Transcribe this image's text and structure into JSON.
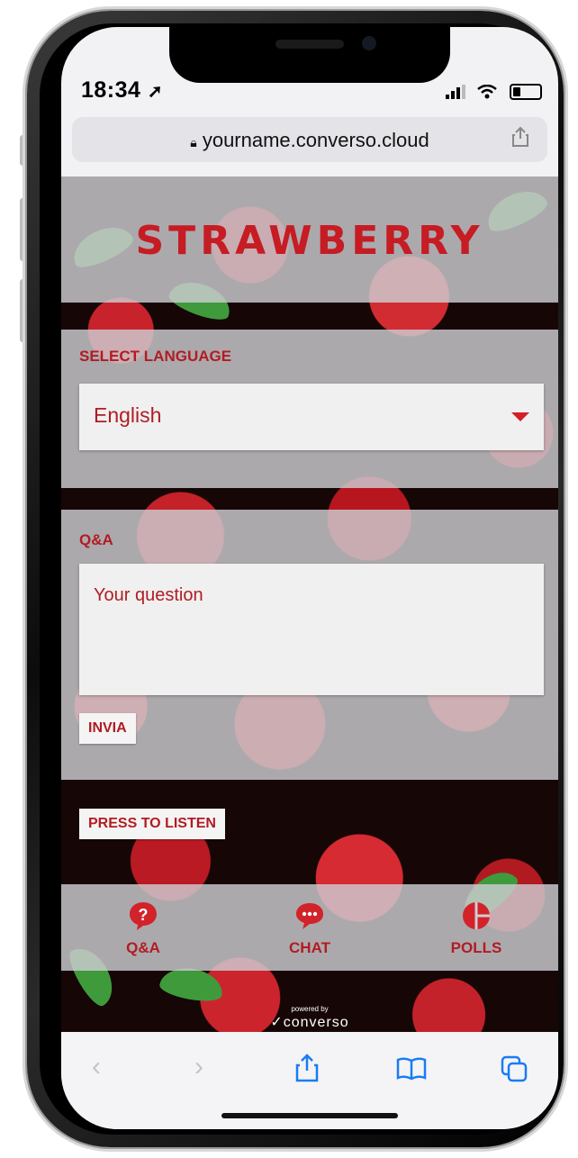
{
  "status_bar": {
    "time": "18:34",
    "location_arrow": "location-arrow-icon",
    "signal": "signal-icon",
    "wifi": "wifi-icon",
    "battery": "battery-icon"
  },
  "browser": {
    "url": "yourname.converso.cloud",
    "lock_icon": "lock-icon",
    "share_icon": "share-icon"
  },
  "header": {
    "logo_text": "STRAWBERRY"
  },
  "language": {
    "label": "SELECT LANGUAGE",
    "selected": "English"
  },
  "qa": {
    "label": "Q&A",
    "placeholder": "Your question",
    "submit_label": "INVIA"
  },
  "listen": {
    "button_label": "PRESS TO LISTEN"
  },
  "bottom_nav": {
    "items": [
      {
        "label": "Q&A",
        "icon": "question-bubble-icon"
      },
      {
        "label": "CHAT",
        "icon": "chat-bubble-icon"
      },
      {
        "label": "POLLS",
        "icon": "pie-chart-icon"
      }
    ]
  },
  "footer": {
    "powered_by": "powered by",
    "brand": "converso"
  },
  "safari_toolbar": {
    "icons": [
      "back-icon",
      "forward-icon",
      "share-icon",
      "bookmarks-icon",
      "tabs-icon"
    ]
  },
  "colors": {
    "accent": "#c61c24",
    "overlay": "#cdcdd2",
    "field_bg": "#f0f0f0"
  }
}
